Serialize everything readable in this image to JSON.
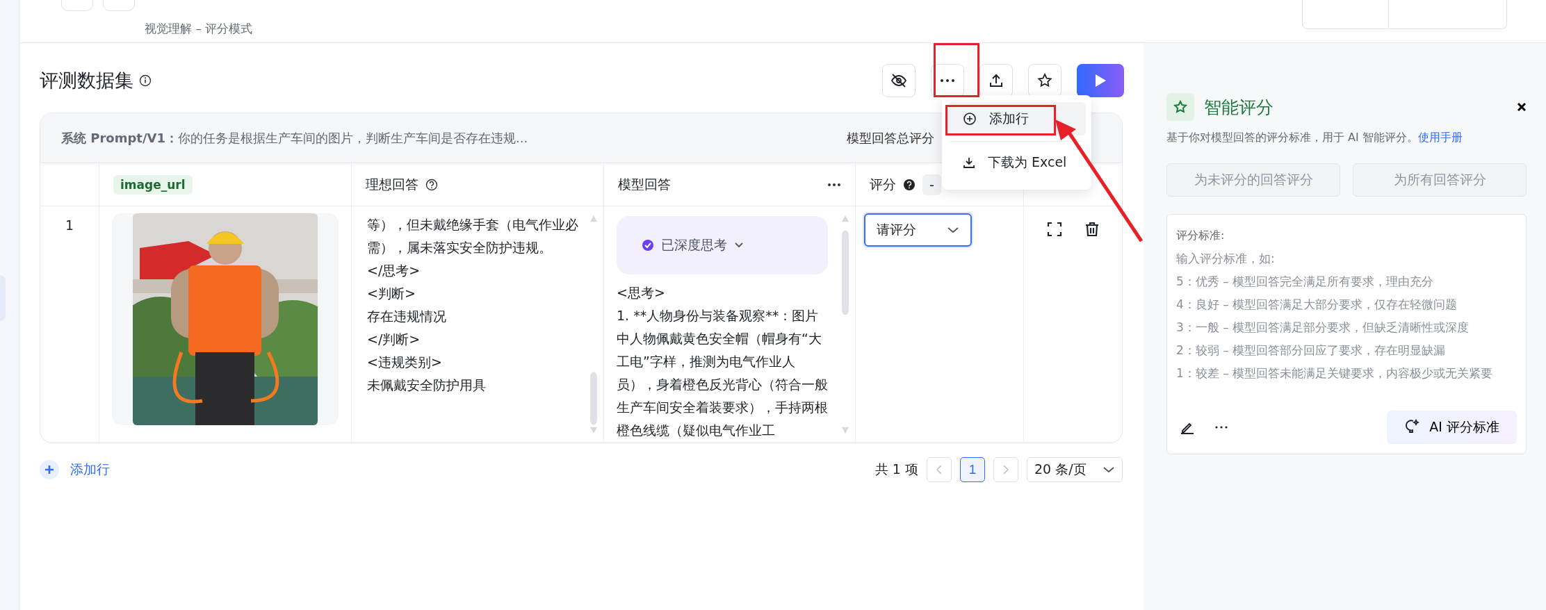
{
  "header": {
    "breadcrumb": "视觉理解 – 评分模式"
  },
  "dataset": {
    "title": "评测数据集"
  },
  "menu": {
    "items": [
      {
        "label": "添加行",
        "kind": "add",
        "selected": true
      },
      {
        "label": "下载为 Excel",
        "kind": "download",
        "selected": false
      }
    ]
  },
  "prompt_bar": {
    "label": "系统 Prompt/V1：",
    "text": "你的任务是根据生产车间的图片，判断生产车间是否存在违规...",
    "total_label": "模型回答总评分"
  },
  "table": {
    "columns": [
      {
        "label": "image_url",
        "kind": "tag"
      },
      {
        "label": "理想回答",
        "kind": "help"
      },
      {
        "label": "模型回答",
        "kind": "more"
      },
      {
        "label": "评分",
        "kind": "score",
        "chip": "-"
      }
    ],
    "rows": [
      {
        "index": "1",
        "ideal_lines": [
          "等），但未戴绝缘手套（电气作业必需），属未落实安全防护违规。",
          "</思考>",
          "<判断>",
          "存在违规情况",
          "</判断>",
          "<违规类别>",
          "未佩戴安全防护用具"
        ],
        "thinking_label": "已深度思考",
        "model_lines": [
          "<思考>",
          "1. **人物身份与装备观察**：图片中人物佩戴黄色安全帽（帽身有“大工电”字样，推测为电气作业人员），身着橙色反光背心（符合一般生产车间安全着装要求），手持两根橙色线缆（疑似电气作业工"
        ],
        "score_placeholder": "请评分"
      }
    ]
  },
  "add_row": "添加行",
  "pagination": {
    "total": "共 1 项",
    "pages": [
      {
        "label": "1",
        "selected": true
      }
    ],
    "page_size": "20 条/页"
  },
  "panel": {
    "title": "智能评分",
    "description": "基于你对模型回答的评分标准，用于 AI 智能评分。",
    "link": "使用手册",
    "buttons": [
      {
        "label": "为未评分的回答评分",
        "disabled": true
      },
      {
        "label": "为所有回答评分",
        "disabled": true
      }
    ],
    "criteria_label": "评分标准:",
    "criteria_placeholder_lines": [
      "输入评分标准，如:",
      "5：优秀 – 模型回答完全满足所有要求，理由充分",
      "4：良好 – 模型回答满足大部分要求，仅存在轻微问题",
      "3：一般 – 模型回答满足部分要求，但缺乏清晰性或深度",
      "2：较弱 – 模型回答部分回应了要求，存在明显缺漏",
      "1：较差 – 模型回答未能满足关键要求，内容极少或无关紧要"
    ],
    "ai_button": "AI 评分标准"
  }
}
